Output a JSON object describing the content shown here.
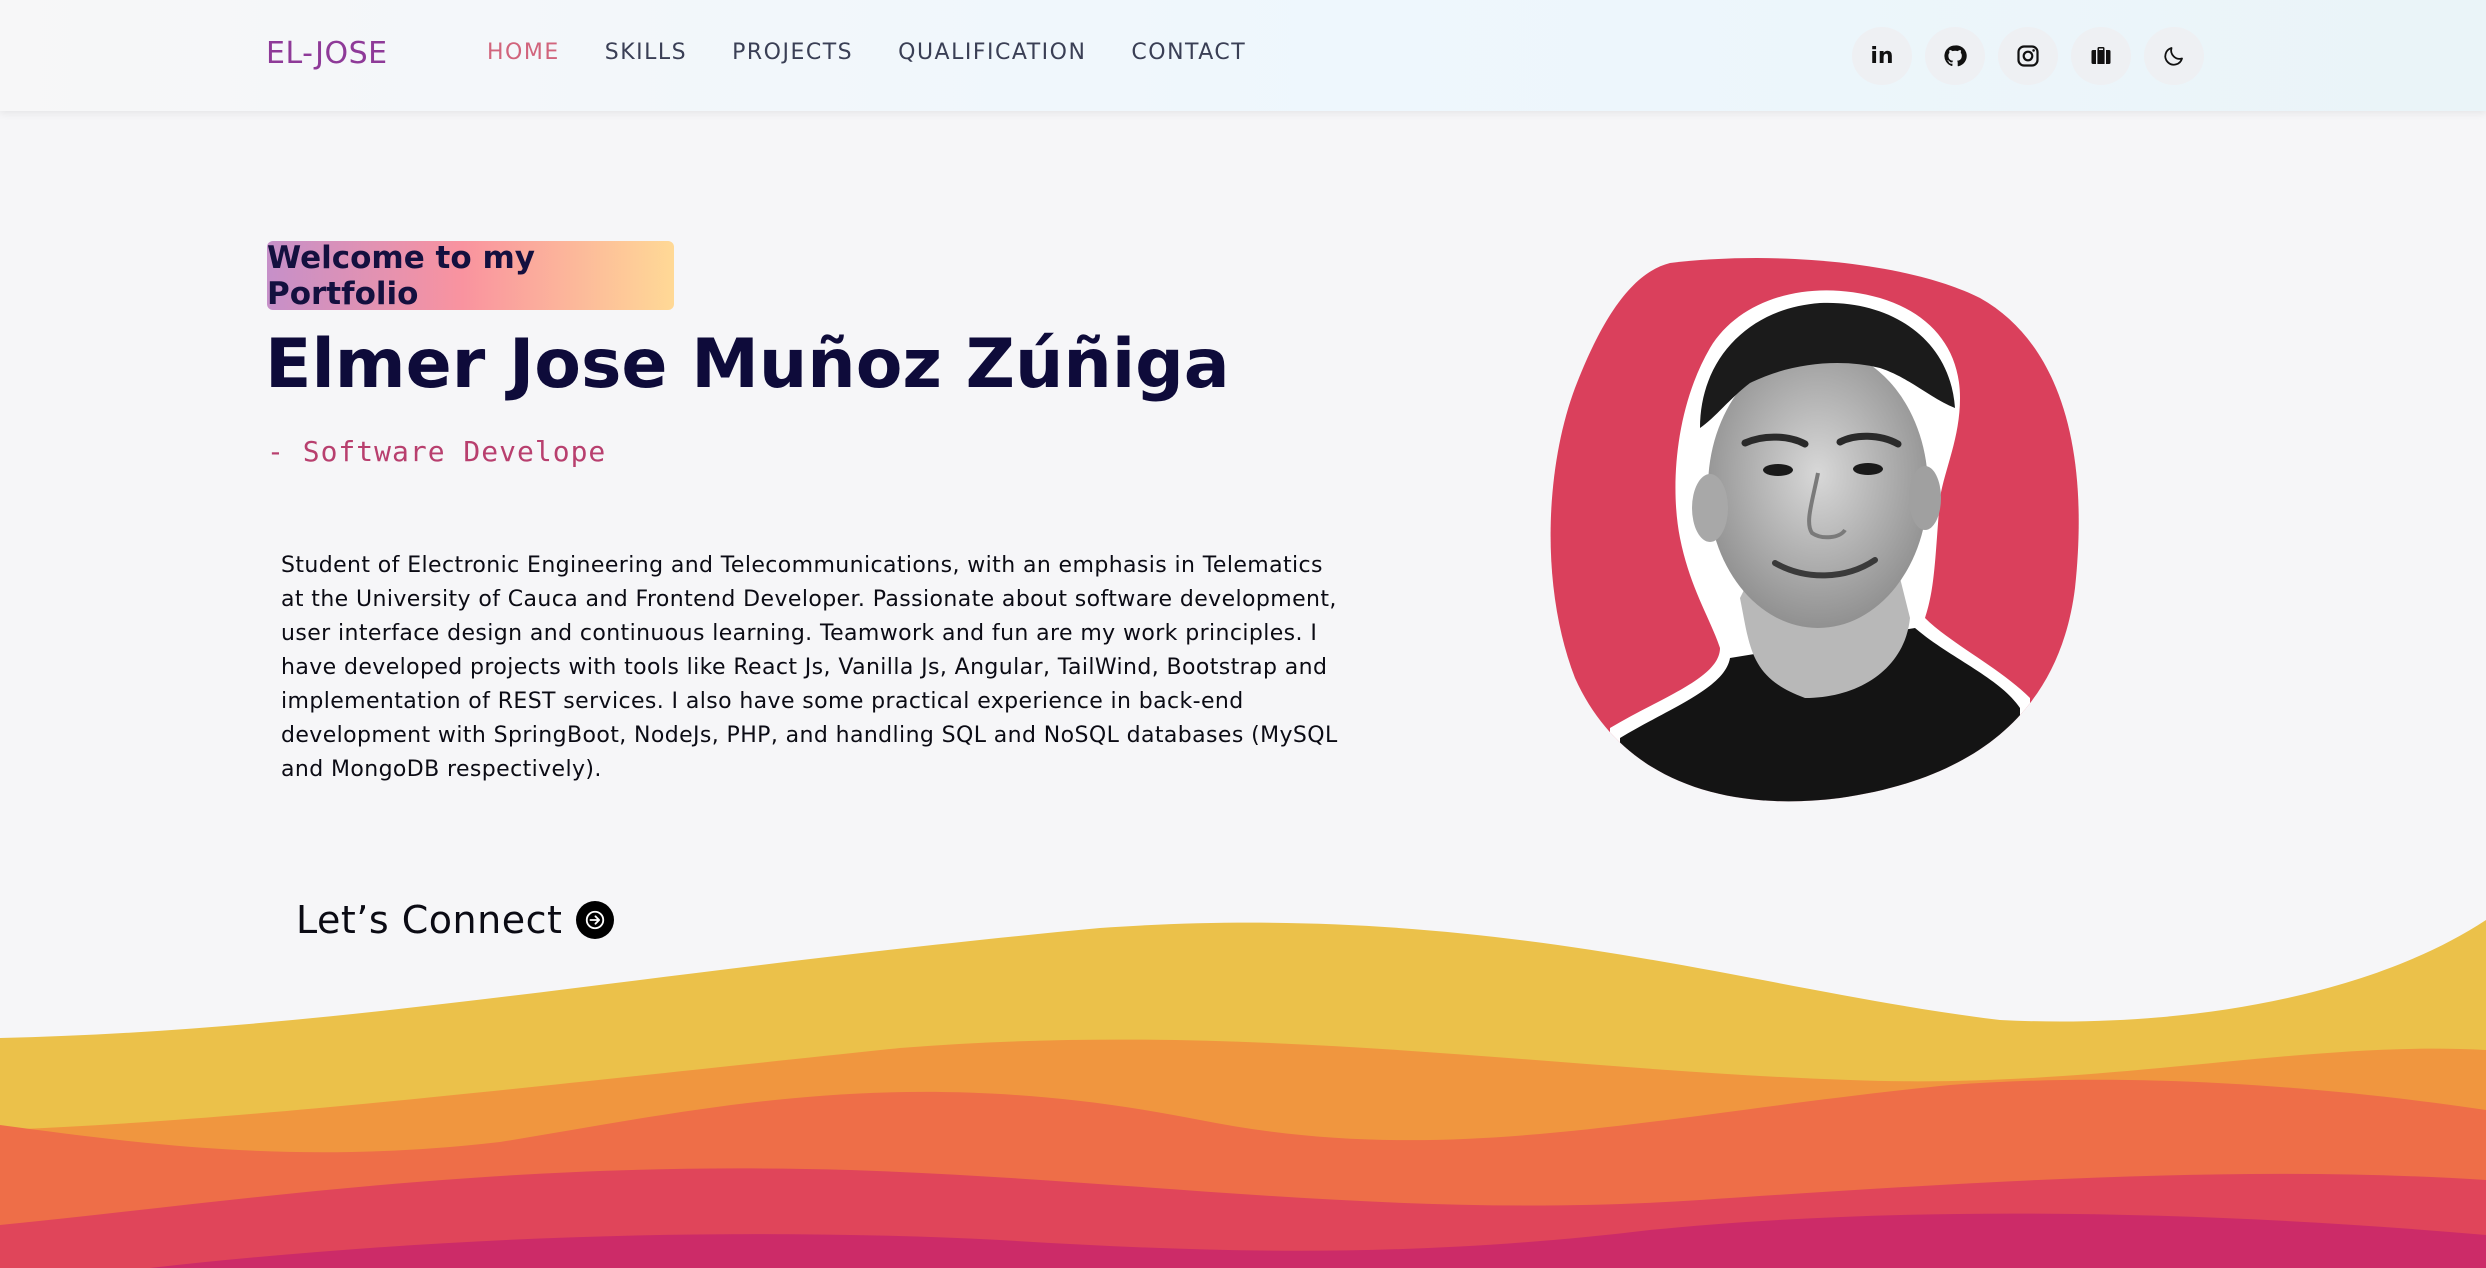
{
  "navbar": {
    "logo": "EL-JOSE",
    "links": [
      {
        "label": "HOME",
        "active": true
      },
      {
        "label": "SKILLS",
        "active": false
      },
      {
        "label": "PROJECTS",
        "active": false
      },
      {
        "label": "QUALIFICATION",
        "active": false
      },
      {
        "label": "CONTACT",
        "active": false
      }
    ],
    "icons": [
      "linkedin-icon",
      "github-icon",
      "instagram-icon",
      "briefcase-icon",
      "moon-icon"
    ],
    "icon_glyphs": {
      "linkedin": "in"
    }
  },
  "hero": {
    "badge": "Welcome to my Portfolio",
    "name": "Elmer Jose Muñoz Zúñiga",
    "role": "- Software Develope",
    "description": "Student of Electronic Engineering and Telecommunications, with an emphasis in Telematics at the University of Cauca and Frontend Developer. Passionate about software development, user interface design and continuous learning. Teamwork and fun are my work principles. I have developed projects with tools like React Js, Vanilla Js, Angular, TailWind, Bootstrap and implementation of REST services. I also have some practical experience in back-end development with SpringBoot, NodeJs, PHP, and handling SQL and NoSQL databases (MySQL and MongoDB respectively).",
    "cta": "Let’s Connect"
  },
  "colors": {
    "accent_pink": "#d1647c",
    "logo_purple": "#8e3a98",
    "portrait_blob": "#da405c",
    "wave_yellow": "#ebc14a",
    "wave_orange": "#f0963f",
    "wave_red_orange": "#ee6e48",
    "wave_pink": "#e0455a",
    "wave_magenta": "#cc2b68"
  }
}
